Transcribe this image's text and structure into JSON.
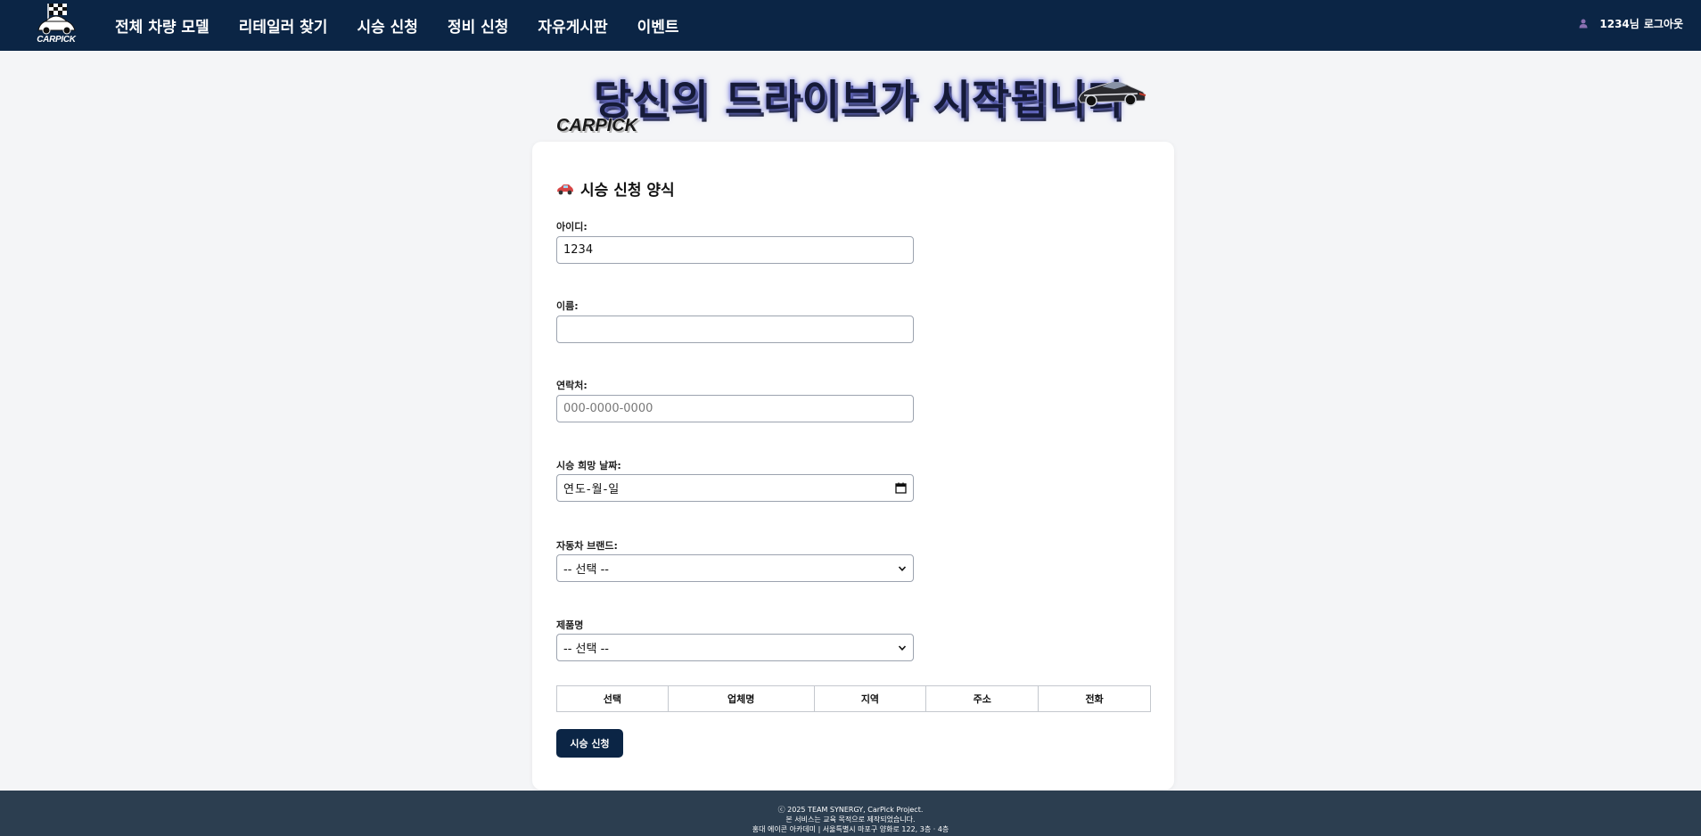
{
  "nav": {
    "logo_text": "CARPICK",
    "links": [
      "전체 차량 모델",
      "리테일러 찾기",
      "시승 신청",
      "정비 신청",
      "자유게시판",
      "이벤트"
    ],
    "user_label": "1234님",
    "logout_label": "로그아웃",
    "colors": {
      "bar": "#0b2545"
    }
  },
  "hero": {
    "headline": "당신의 드라이브가 시작됩니다",
    "brand": "CARPICK"
  },
  "form": {
    "title": "시승 신청 양식",
    "title_icon": "car-icon",
    "fields": {
      "id": {
        "label": "아이디:",
        "value": "1234"
      },
      "name": {
        "label": "이름:",
        "value": ""
      },
      "phone": {
        "label": "연락처:",
        "value": "",
        "placeholder": "000-0000-0000"
      },
      "date": {
        "label": "시승 희망 날짜:",
        "value": "연도-월-일"
      },
      "brand": {
        "label": "자동차 브랜드:",
        "selected": "-- 선택 --"
      },
      "product": {
        "label": "제품명",
        "selected": "-- 선택 --"
      }
    },
    "table_headers": [
      "선택",
      "업체명",
      "지역",
      "주소",
      "전화"
    ],
    "submit_label": "시승 신청"
  },
  "footer": {
    "line1": "ⓒ 2025 TEAM SYNERGY, CarPick Project.",
    "line2": "본 서비스는 교육 목적으로 제작되었습니다.",
    "line3": "홍대 에이콘 아카데미 | 서울특별시 마포구 양화로 122, 3층 · 4층"
  },
  "colors": {
    "accent": "#0b2545",
    "footer": "#2c3e50",
    "background": "#f4f5f7"
  }
}
